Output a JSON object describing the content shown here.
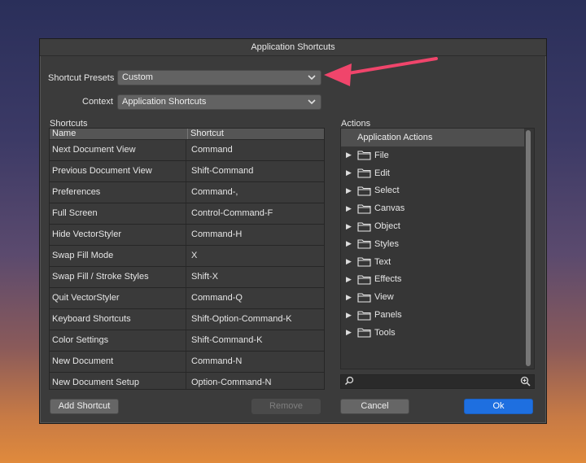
{
  "dialog": {
    "title": "Application Shortcuts"
  },
  "presets": {
    "label": "Shortcut Presets",
    "value": "Custom"
  },
  "context": {
    "label": "Context",
    "value": "Application Shortcuts"
  },
  "shortcuts": {
    "label": "Shortcuts",
    "columns": [
      "Name",
      "Shortcut"
    ],
    "rows": [
      [
        "Next Document View",
        "Command"
      ],
      [
        "Previous Document View",
        "Shift-Command"
      ],
      [
        "Preferences",
        "Command-,"
      ],
      [
        "Full Screen",
        "Control-Command-F"
      ],
      [
        "Hide VectorStyler",
        "Command-H"
      ],
      [
        "Swap Fill Mode",
        "X"
      ],
      [
        "Swap Fill / Stroke Styles",
        "Shift-X"
      ],
      [
        "Quit VectorStyler",
        "Command-Q"
      ],
      [
        "Keyboard Shortcuts",
        "Shift-Option-Command-K"
      ],
      [
        "Color Settings",
        "Shift-Command-K"
      ],
      [
        "New Document",
        "Command-N"
      ],
      [
        "New Document Setup",
        "Option-Command-N"
      ]
    ]
  },
  "actions": {
    "label": "Actions",
    "header": "Application Actions",
    "items": [
      "File",
      "Edit",
      "Select",
      "Canvas",
      "Object",
      "Styles",
      "Text",
      "Effects",
      "View",
      "Panels",
      "Tools"
    ]
  },
  "buttons": {
    "add_shortcut": "Add Shortcut",
    "remove": "Remove",
    "cancel": "Cancel",
    "ok": "Ok"
  },
  "colors": {
    "annotation_arrow": "#f0456b",
    "ok_button": "#1e6fe0"
  }
}
